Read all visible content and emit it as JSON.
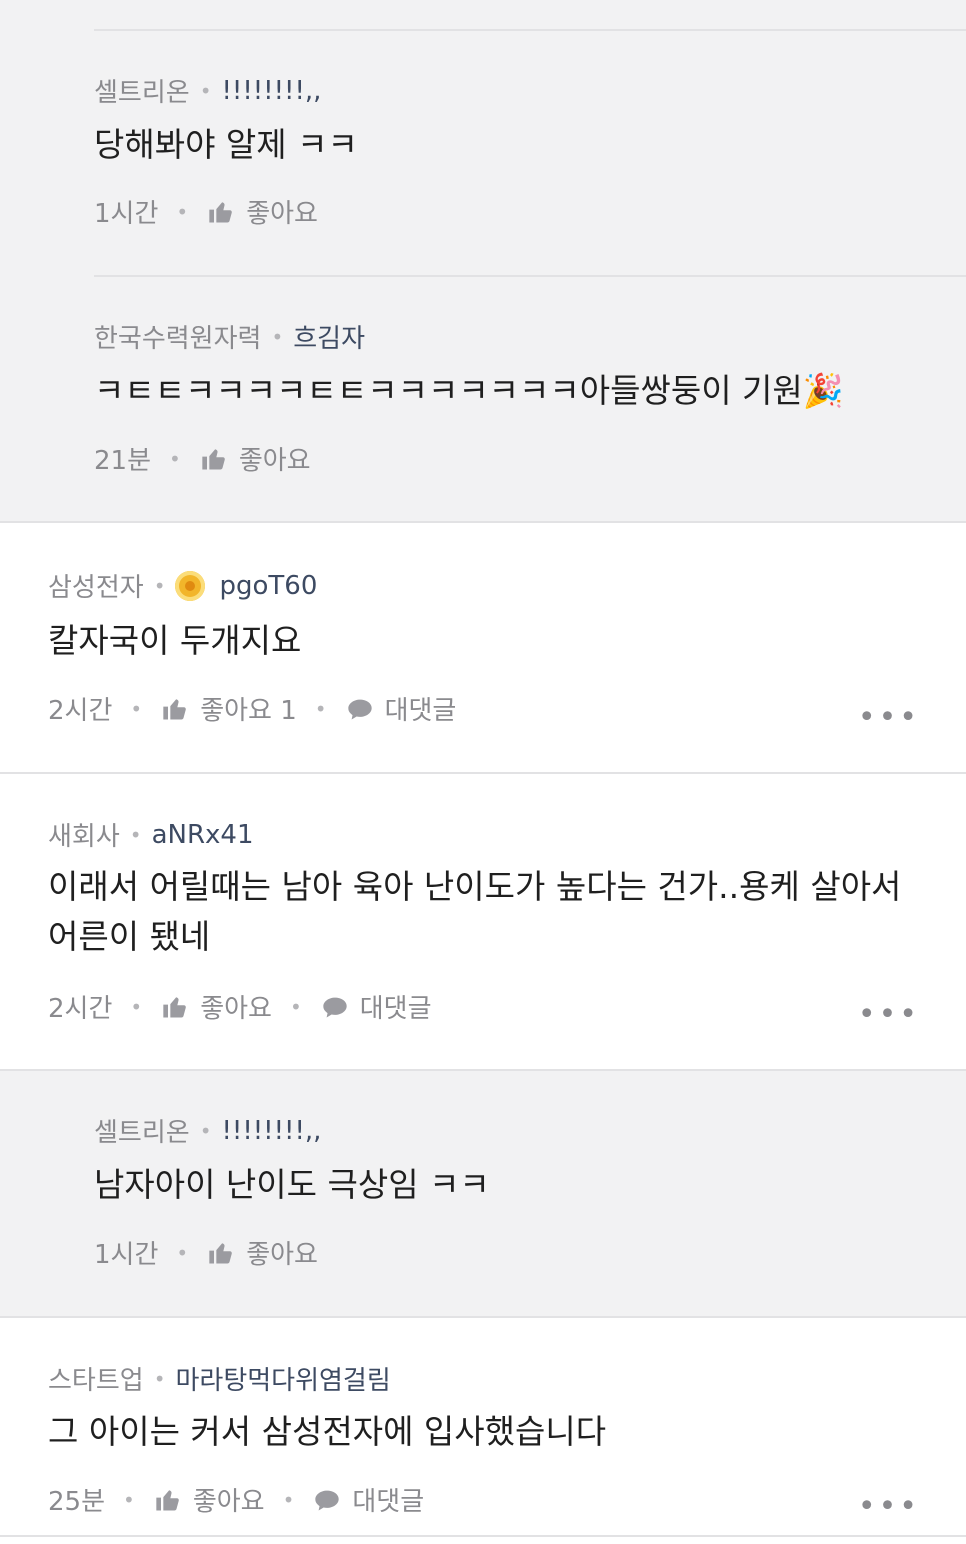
{
  "comments": [
    {
      "company": "셀트리온",
      "nick": "!!!!!!!!,,",
      "text": "당해봐야 알제 ㅋㅋ",
      "time": "1시간",
      "like_label": "좋아요"
    },
    {
      "company": "한국수력원자력",
      "nick": "흐김자",
      "text": "ㅋㅌㅌㅋㅋㅋㅋㅌㅌㅋㅋㅋㅋㅋㅋㅋ아들쌍둥이 기원🎉",
      "time": "21분",
      "like_label": "좋아요"
    },
    {
      "company": "삼성전자",
      "nick": "pgoT60",
      "text": "칼자국이 두개지요",
      "time": "2시간",
      "like_label": "좋아요 1",
      "reply_label": "대댓글",
      "more": "•••"
    },
    {
      "company": "새회사",
      "nick": "aNRx41",
      "text": "이래서 어릴때는 남아 육아 난이도가 높다는 건가..용케 살아서 어른이 됐네",
      "time": "2시간",
      "like_label": "좋아요",
      "reply_label": "대댓글",
      "more": "•••"
    },
    {
      "company": "셀트리온",
      "nick": "!!!!!!!!,,",
      "text": "남자아이 난이도 극상임 ㅋㅋ",
      "time": "1시간",
      "like_label": "좋아요"
    },
    {
      "company": "스타트업",
      "nick": "마라탕먹다위염걸림",
      "text": "그 아이는 커서 삼성전자에 입사했습니다",
      "time": "25분",
      "like_label": "좋아요",
      "reply_label": "대댓글",
      "more": "•••"
    }
  ],
  "colors": {
    "reply_bg": "#f2f2f3",
    "company": "#8a8a8e",
    "nick": "#3d4a62",
    "badge": "#f2b52a"
  },
  "icons": {
    "like": "thumbs-up-icon",
    "reply": "speech-bubble-icon",
    "more": "more-dots-icon",
    "badge": "gold-badge-icon"
  }
}
